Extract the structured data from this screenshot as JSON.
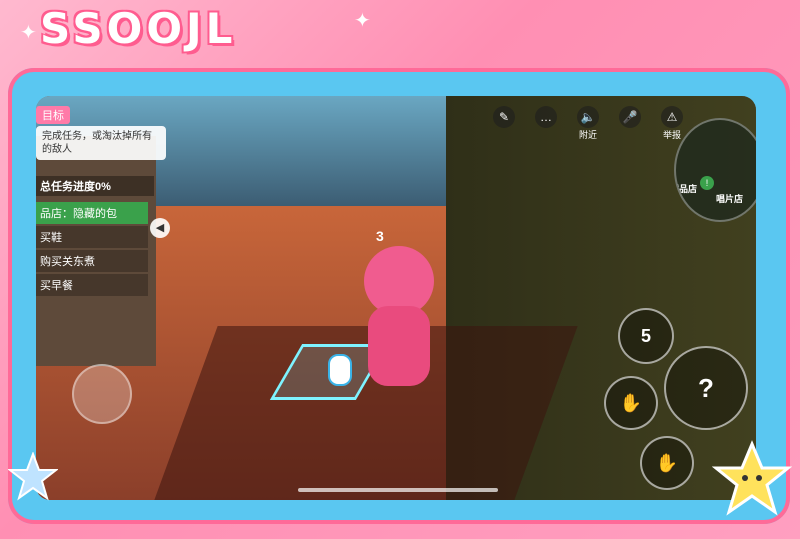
{
  "game": {
    "mission_tag": "目标",
    "mission_desc": "完成任务，或淘汰掉所有的敌人",
    "progress_label": "总任务进度0%",
    "tasks": [
      {
        "label": "品店：隐藏的包",
        "active": true
      },
      {
        "label": "买鞋",
        "active": false
      },
      {
        "label": "购买关东煮",
        "active": false
      },
      {
        "label": "买早餐",
        "active": false
      }
    ],
    "character_marker": "3"
  },
  "topbar": {
    "items": [
      {
        "icon": "task-note-icon",
        "glyph": "✎",
        "label": ""
      },
      {
        "icon": "chat-icon",
        "glyph": "…",
        "label": ""
      },
      {
        "icon": "speaker-icon",
        "glyph": "🔈",
        "label": "附近"
      },
      {
        "icon": "mic-muted-icon",
        "glyph": "🎤",
        "label": ""
      },
      {
        "icon": "report-icon",
        "glyph": "⚠",
        "label": "举报"
      }
    ]
  },
  "minimap": {
    "label_shop": "唱片店",
    "label_partial": "甜品店",
    "alert_glyph": "!"
  },
  "skills": {
    "skill_5_label": "5",
    "main_glyph": "?",
    "b_glyph": "✋",
    "c_glyph": "✋"
  },
  "colors": {
    "frame_pink": "#ff8fb3",
    "tablet_blue": "#5ac7f1",
    "task_active_green": "#3aa14b"
  }
}
